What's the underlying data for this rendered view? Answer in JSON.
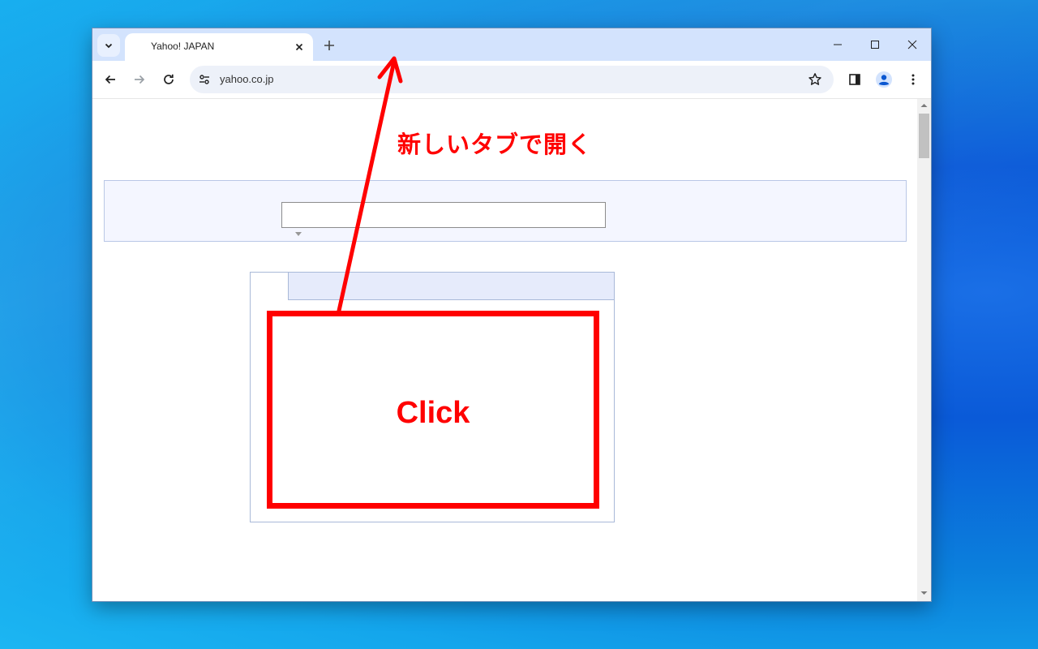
{
  "browser": {
    "tab": {
      "title": "Yahoo! JAPAN",
      "close_glyph": "✕"
    },
    "new_tab_glyph": "+",
    "address": "yahoo.co.jp"
  },
  "annotation": {
    "instruction": "新しいタブで開く",
    "click_label": "Click",
    "color": "#ff0000"
  },
  "icons": {
    "tab_search": "chevron-down-icon",
    "back": "back-arrow-icon",
    "forward": "forward-arrow-icon",
    "reload": "reload-icon",
    "site_info": "tune-icon",
    "bookmark": "star-icon",
    "side_panel": "side-panel-icon",
    "profile": "profile-icon",
    "menu": "kebab-menu-icon",
    "minimize": "minimize-icon",
    "maximize": "maximize-icon",
    "close": "close-icon"
  }
}
